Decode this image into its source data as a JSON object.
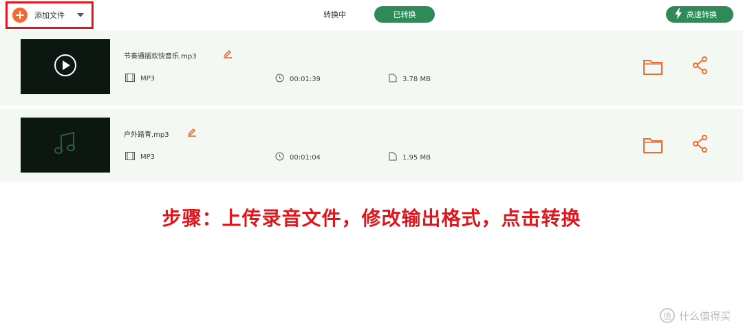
{
  "toolbar": {
    "add_file_label": "添加文件",
    "tab_converting": "转换中",
    "tab_converted": "已转换",
    "fast_convert_label": "高速转换"
  },
  "files": [
    {
      "name": "节奏通插欢快音乐.mp3",
      "format": "MP3",
      "duration": "00:01:39",
      "size": "3.78 MB"
    },
    {
      "name": "户外路青.mp3",
      "format": "MP3",
      "duration": "00:01:04",
      "size": "1.95 MB"
    }
  ],
  "instruction": "步骤：上传录音文件，修改输出格式，点击转换",
  "watermark": {
    "symbol": "值",
    "text": "什么值得买"
  },
  "colors": {
    "accent_green": "#2e8b57",
    "accent_orange": "#f26a2e",
    "highlight_red": "#e0161c",
    "row_bg": "#f3f8f3"
  },
  "icons": [
    "plus-icon",
    "caret-down-icon",
    "lightning-icon",
    "play-icon",
    "music-note-icon",
    "edit-icon",
    "film-icon",
    "clock-icon",
    "file-icon",
    "folder-icon",
    "share-icon"
  ]
}
